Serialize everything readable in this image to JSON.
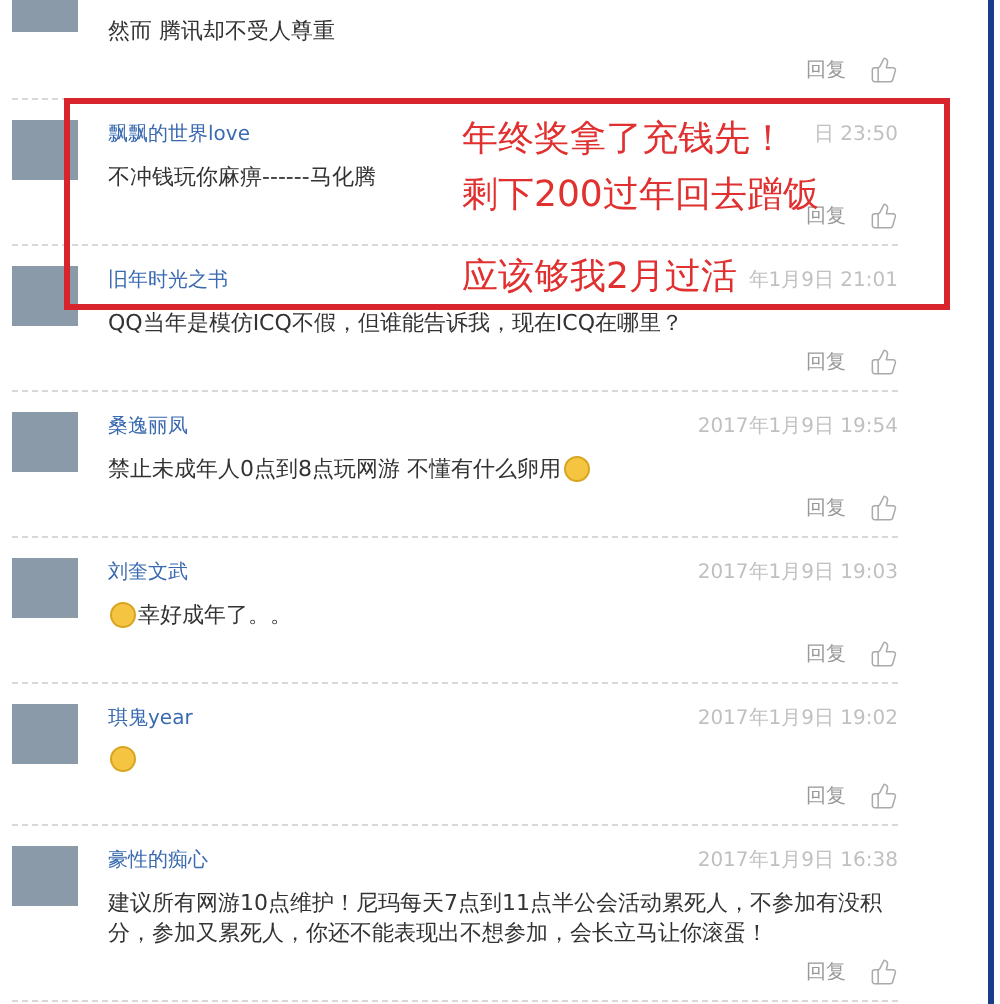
{
  "comments": [
    {
      "text": "然而 腾讯却不受人尊重",
      "leading_emoji": false,
      "trailing_emoji": false,
      "reply": "回复"
    },
    {
      "name": "飘飘的世界love",
      "time": "日 23:50",
      "text": "不冲钱玩你麻痹------马化腾",
      "leading_emoji": false,
      "trailing_emoji": false,
      "reply": "回复"
    },
    {
      "name": "旧年时光之书",
      "time": "年1月9日 21:01",
      "text": "QQ当年是模仿ICQ不假，但谁能告诉我，现在ICQ在哪里？",
      "leading_emoji": false,
      "trailing_emoji": false,
      "reply": "回复"
    },
    {
      "name": "桑逸丽凤",
      "time": "2017年1月9日 19:54",
      "text": "禁止未成年人0点到8点玩网游 不懂有什么卵用",
      "leading_emoji": false,
      "trailing_emoji": true,
      "reply": "回复"
    },
    {
      "name": "刘奎文武",
      "time": "2017年1月9日 19:03",
      "text": "幸好成年了。。",
      "leading_emoji": true,
      "trailing_emoji": false,
      "reply": "回复"
    },
    {
      "name": "琪鬼year",
      "time": "2017年1月9日 19:02",
      "leading_emoji": true,
      "trailing_emoji": false,
      "reply": "回复"
    },
    {
      "name": "豪性的痴心",
      "time": "2017年1月9日 16:38",
      "text": "建议所有网游10点维护！尼玛每天7点到11点半公会活动累死人，不参加有没积分，参加又累死人，你还不能表现出不想参加，会长立马让你滚蛋！",
      "leading_emoji": false,
      "trailing_emoji": false,
      "reply": "回复"
    }
  ],
  "overlay": {
    "lines": [
      "年终奖拿了充钱先！",
      "剩下200过年回去蹭饭",
      "应该够我2月过活"
    ]
  }
}
